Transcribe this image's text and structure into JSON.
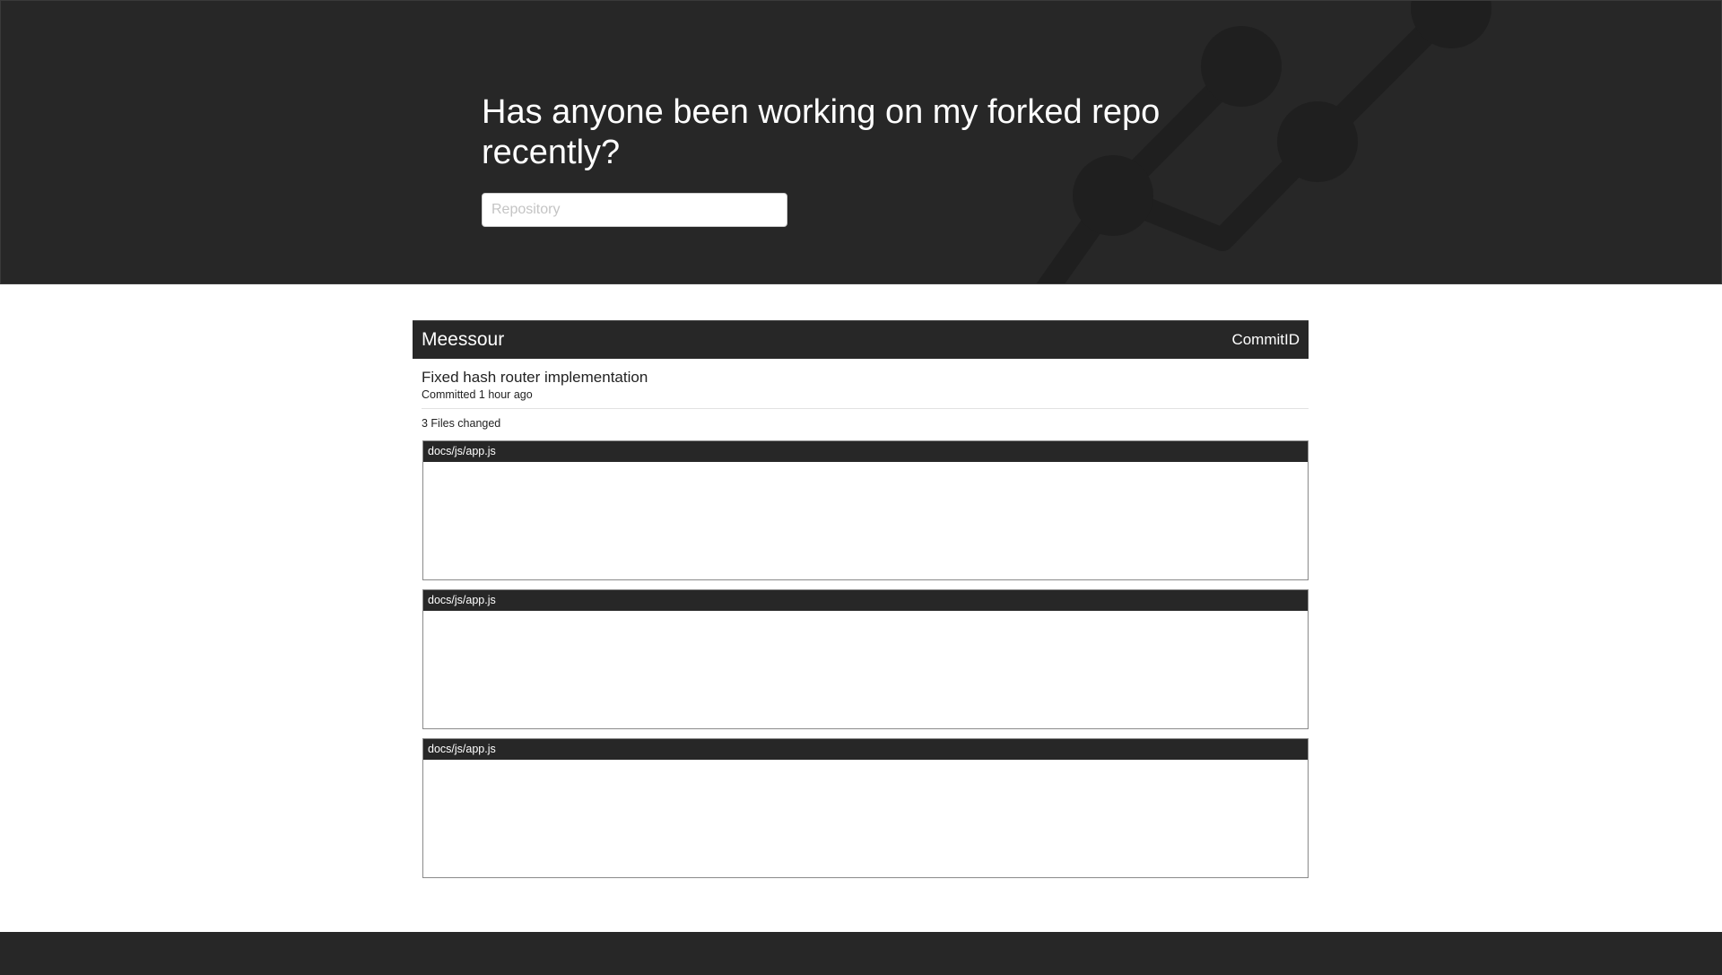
{
  "hero": {
    "title": "Has anyone been working on my forked repo recently?",
    "search": {
      "placeholder": "Repository",
      "value": ""
    }
  },
  "commit": {
    "author": "Meessour",
    "commit_id_label": "CommitID",
    "message": "Fixed hash router implementation",
    "committed": "Committed 1 hour ago",
    "files_changed": "3 Files changed",
    "files": [
      {
        "path": "docs/js/app.js"
      },
      {
        "path": "docs/js/app.js"
      },
      {
        "path": "docs/js/app.js"
      }
    ]
  },
  "colors": {
    "dark": "#272727",
    "graphic": "#1f1f1f",
    "background": "#ffffff"
  },
  "icons": {
    "hero_graphic": "git-branch-graph-icon"
  }
}
